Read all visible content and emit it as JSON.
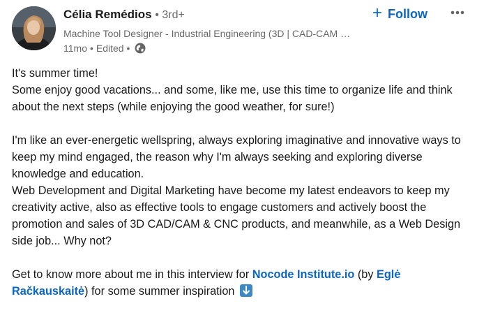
{
  "author": {
    "name": "Célia Remédios",
    "degree": "• 3rd+",
    "headline": "Machine Tool Designer - Industrial Engineering (3D | CAD-CAM …",
    "time": "11mo",
    "separator": "•",
    "edited": "Edited •",
    "visibility_icon": "globe-icon"
  },
  "actions": {
    "follow_plus": "+",
    "follow_label": "Follow",
    "more_icon": "ellipsis-icon"
  },
  "post": {
    "line1": "It's summer time!",
    "line2": "Some enjoy good vacations... and some, like me, use this time to organize life and think about the next steps (while enjoying the good weather, for sure!)",
    "para2": "I'm like an ever-energetic wellspring, always exploring imaginative and innovative ways to keep my mind engaged, the reason why I'm always seeking and exploring diverse knowledge and education.",
    "para3": "Web Development and Digital Marketing have become my latest endeavors to keep my creativity active, also as effective tools to engage customers and actively boost the promotion and sales of 3D CAD/CAM & CNC products, and meanwhile, as a Web Design side job... Why not?",
    "para4_prefix": "Get to know more about me in this interview for ",
    "mention_company": "Nocode Institute.io",
    "para4_mid": " (by ",
    "mention_person": "Eglė Račkauskaitė",
    "para4_suffix": ") for some summer inspiration ",
    "emoji_icon": "down-arrow-emoji-icon"
  },
  "colors": {
    "link": "#0a66c2",
    "secondary_text": "rgba(0,0,0,0.6)",
    "primary_text": "rgba(0,0,0,0.9)",
    "emoji_bg": "#3b88c3"
  }
}
